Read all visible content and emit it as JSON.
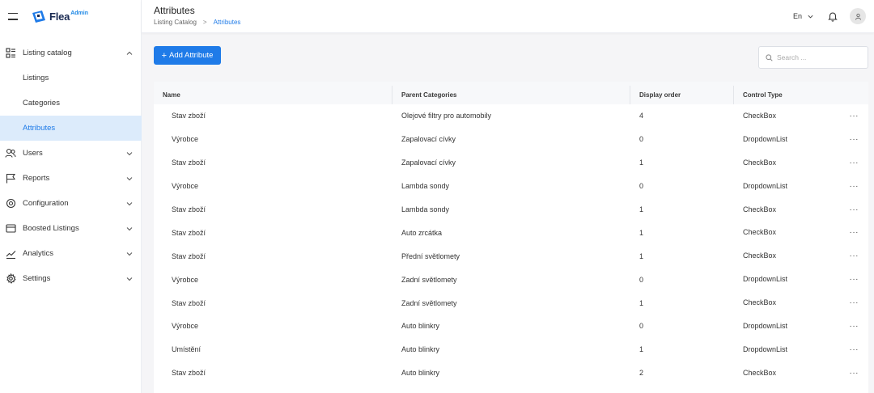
{
  "app": {
    "logo_text": "Flea",
    "logo_sup": "Admin"
  },
  "header": {
    "title": "Attributes",
    "breadcrumb": [
      "Listing Catalog",
      "Attributes"
    ],
    "language": "En"
  },
  "sidebar": {
    "items": [
      {
        "label": "Listing catalog",
        "icon": "grid-list-icon",
        "expanded": true,
        "children": [
          {
            "label": "Listings",
            "active": false
          },
          {
            "label": "Categories",
            "active": false
          },
          {
            "label": "Attributes",
            "active": true
          }
        ]
      },
      {
        "label": "Users",
        "icon": "users-icon"
      },
      {
        "label": "Reports",
        "icon": "flag-icon"
      },
      {
        "label": "Configuration",
        "icon": "gear-icon"
      },
      {
        "label": "Boosted Listings",
        "icon": "card-icon"
      },
      {
        "label": "Analytics",
        "icon": "chart-line-icon"
      },
      {
        "label": "Settings",
        "icon": "settings-icon"
      }
    ]
  },
  "toolbar": {
    "add_label": "Add Attribute",
    "search_placeholder": "Search ..."
  },
  "table": {
    "columns": [
      "Name",
      "Parent Categories",
      "Display order",
      "Control Type"
    ],
    "rows": [
      {
        "name": "Stav zboží",
        "parent": "Olejové filtry pro automobily",
        "order": "4",
        "control": "CheckBox"
      },
      {
        "name": "Výrobce",
        "parent": "Zapalovací cívky",
        "order": "0",
        "control": "DropdownList"
      },
      {
        "name": "Stav zboží",
        "parent": "Zapalovací cívky",
        "order": "1",
        "control": "CheckBox"
      },
      {
        "name": "Výrobce",
        "parent": "Lambda sondy",
        "order": "0",
        "control": "DropdownList"
      },
      {
        "name": "Stav zboží",
        "parent": "Lambda sondy",
        "order": "1",
        "control": "CheckBox"
      },
      {
        "name": "Stav zboží",
        "parent": "Auto zrcátka",
        "order": "1",
        "control": "CheckBox"
      },
      {
        "name": "Stav zboží",
        "parent": "Přední světlomety",
        "order": "1",
        "control": "CheckBox"
      },
      {
        "name": "Výrobce",
        "parent": "Zadní světlomety",
        "order": "0",
        "control": "DropdownList"
      },
      {
        "name": "Stav zboží",
        "parent": "Zadní světlomety",
        "order": "1",
        "control": "CheckBox"
      },
      {
        "name": "Výrobce",
        "parent": "Auto blinkry",
        "order": "0",
        "control": "DropdownList"
      },
      {
        "name": "Umístění",
        "parent": "Auto blinkry",
        "order": "1",
        "control": "DropdownList"
      },
      {
        "name": "Stav zboží",
        "parent": "Auto blinkry",
        "order": "2",
        "control": "CheckBox"
      }
    ]
  },
  "colors": {
    "accent": "#1f7be8",
    "active_bg": "#dcebfb",
    "page_bg": "#f5f5f7"
  }
}
